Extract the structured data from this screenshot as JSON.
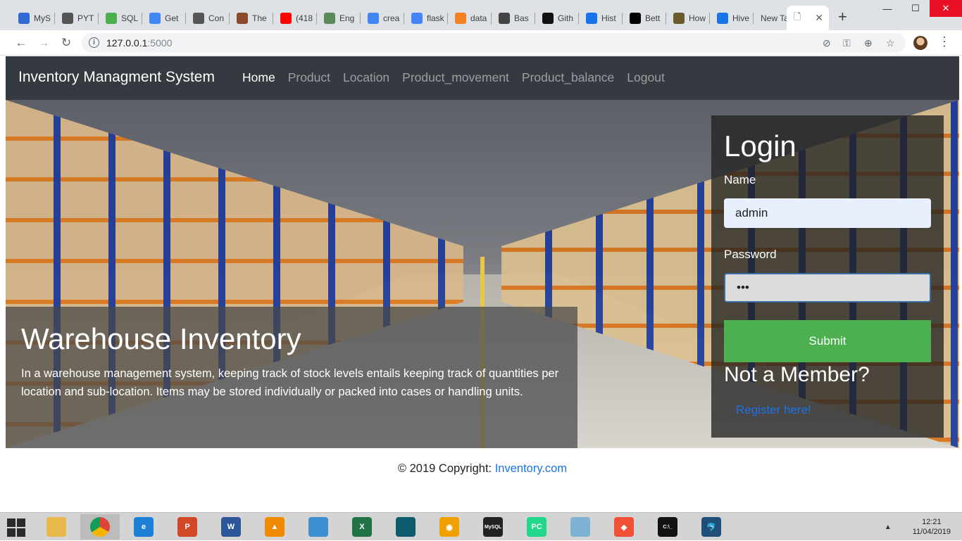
{
  "browser": {
    "tabs": [
      {
        "label": "MyS",
        "icon": "a-logo-icon",
        "color": "#3367d6"
      },
      {
        "label": "PYT",
        "icon": "grid-icon",
        "color": "#555555"
      },
      {
        "label": "SQL",
        "icon": "sql-icon",
        "color": "#4cae4c"
      },
      {
        "label": "Get",
        "icon": "cloud-icon",
        "color": "#4285f4"
      },
      {
        "label": "Con",
        "icon": "moon-icon",
        "color": "#555555"
      },
      {
        "label": "The",
        "icon": "photo-icon",
        "color": "#8b4a2b"
      },
      {
        "label": "(418",
        "icon": "youtube-icon",
        "color": "#ff0000"
      },
      {
        "label": "Eng",
        "icon": "circle-icon",
        "color": "#5a8a5a"
      },
      {
        "label": "crea",
        "icon": "google-icon",
        "color": "#4285f4"
      },
      {
        "label": "flask",
        "icon": "google-icon",
        "color": "#4285f4"
      },
      {
        "label": "data",
        "icon": "stack-icon",
        "color": "#f48024"
      },
      {
        "label": "Bas",
        "icon": "grid-icon",
        "color": "#444444"
      },
      {
        "label": "Gith",
        "icon": "github-icon",
        "color": "#111111"
      },
      {
        "label": "Hist",
        "icon": "history-icon",
        "color": "#1a73e8"
      },
      {
        "label": "Bett",
        "icon": "medium-icon",
        "color": "#000000"
      },
      {
        "label": "How",
        "icon": "person-icon",
        "color": "#6b5a2b"
      },
      {
        "label": "Hive",
        "icon": "bars-icon",
        "color": "#1a73e8"
      },
      {
        "label": "New Tab",
        "icon": "",
        "color": ""
      }
    ],
    "active_tab_label": "",
    "new_tab_symbol": "+",
    "url_host": "127.0.0.1",
    "url_port": ":5000",
    "info_symbol": "i"
  },
  "nav": {
    "brand": "Inventory Managment System",
    "links": [
      "Home",
      "Product",
      "Location",
      "Product_movement",
      "Product_balance",
      "Logout"
    ]
  },
  "hero": {
    "title": "Warehouse Inventory",
    "description": "In a warehouse management system, keeping track of stock levels entails keeping track of quantities per location and sub-location. Items may be stored individually or packed into cases or handling units."
  },
  "login": {
    "title": "Login",
    "name_label": "Name",
    "name_value": "admin",
    "password_label": "Password",
    "password_value": "•••",
    "submit_label": "Submit",
    "not_member": "Not a Member?",
    "register_link": "Register here!"
  },
  "footer": {
    "text": "© 2019 Copyright: ",
    "link": "Inventory.com"
  },
  "taskbar": {
    "apps": [
      {
        "name": "file-explorer",
        "color": "#e8b84a",
        "glyph": ""
      },
      {
        "name": "chrome",
        "color": "#4285f4",
        "glyph": ""
      },
      {
        "name": "internet-explorer",
        "color": "#1e7fd6",
        "glyph": "e"
      },
      {
        "name": "powerpoint",
        "color": "#d24726",
        "glyph": "P"
      },
      {
        "name": "word",
        "color": "#2b579a",
        "glyph": "W"
      },
      {
        "name": "vlc",
        "color": "#f08a00",
        "glyph": "▲"
      },
      {
        "name": "control-panel",
        "color": "#3c8fd1",
        "glyph": ""
      },
      {
        "name": "excel",
        "color": "#217346",
        "glyph": "X"
      },
      {
        "name": "notebook",
        "color": "#0e5a6e",
        "glyph": ""
      },
      {
        "name": "audacity",
        "color": "#f0a000",
        "glyph": "◉"
      },
      {
        "name": "mysql-shell",
        "color": "#222222",
        "glyph": "MySQL"
      },
      {
        "name": "pycharm",
        "color": "#21d789",
        "glyph": "PC"
      },
      {
        "name": "notepad",
        "color": "#7fb3d5",
        "glyph": ""
      },
      {
        "name": "git",
        "color": "#f05033",
        "glyph": "◆"
      },
      {
        "name": "cmd",
        "color": "#111111",
        "glyph": "C:\\_"
      },
      {
        "name": "mysql-workbench",
        "color": "#1f4e79",
        "glyph": "🐬"
      }
    ],
    "time": "12:21",
    "date": "11/04/2019"
  }
}
